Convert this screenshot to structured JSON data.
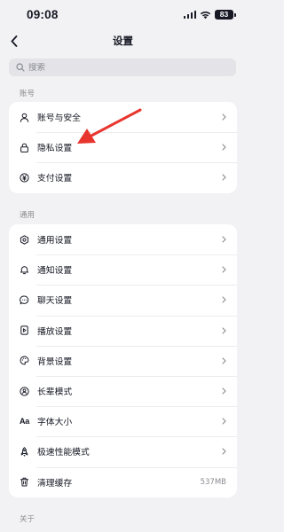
{
  "status_bar": {
    "time": "09:08",
    "battery": "83",
    "icons": [
      "signal-icon",
      "wifi-icon",
      "battery-icon"
    ]
  },
  "header": {
    "title": "设置",
    "back_icon": "chevron-left-icon"
  },
  "search": {
    "placeholder": "搜索",
    "value": ""
  },
  "sections": [
    {
      "title": "账号",
      "items": [
        {
          "label": "账号与安全",
          "icon": "user-icon"
        },
        {
          "label": "隐私设置",
          "icon": "lock-icon"
        },
        {
          "label": "支付设置",
          "icon": "yen-coin-icon"
        }
      ]
    },
    {
      "title": "通用",
      "items": [
        {
          "label": "通用设置",
          "icon": "gear-icon"
        },
        {
          "label": "通知设置",
          "icon": "bell-icon"
        },
        {
          "label": "聊天设置",
          "icon": "chat-bubble-icon"
        },
        {
          "label": "播放设置",
          "icon": "play-icon"
        },
        {
          "label": "背景设置",
          "icon": "palette-icon"
        },
        {
          "label": "长辈模式",
          "icon": "elder-mode-icon"
        },
        {
          "label": "字体大小",
          "icon": "font-size-icon",
          "icon_text": "Aa"
        },
        {
          "label": "极速性能模式",
          "icon": "rocket-icon"
        },
        {
          "label": "清理缓存",
          "icon": "trash-icon",
          "value": "537MB"
        }
      ]
    },
    {
      "title": "关于",
      "items": []
    }
  ],
  "annotation": {
    "type": "red-arrow",
    "color": "#e8352e",
    "points_to": "隐私设置"
  },
  "colors": {
    "background": "#f2f2f4",
    "card": "#ffffff",
    "text_primary": "#161823",
    "text_secondary": "#8a8b91",
    "search_bg": "#e4e4e8",
    "arrow": "#e8352e"
  }
}
